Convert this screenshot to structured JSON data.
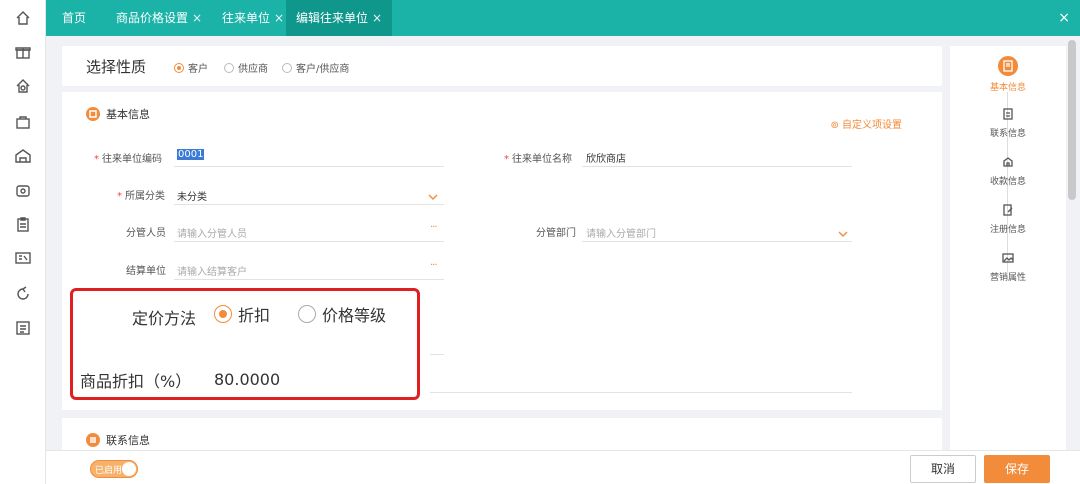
{
  "tabs": [
    {
      "label": "首页",
      "closable": false
    },
    {
      "label": "商品价格设置",
      "closable": true
    },
    {
      "label": "往来单位",
      "closable": true
    },
    {
      "label": "编辑往来单位",
      "closable": true
    }
  ],
  "tab_close_glyph": "×",
  "header": {
    "title": "选择性质",
    "options": [
      "客户",
      "供应商",
      "客户/供应商"
    ],
    "selected": "客户"
  },
  "basic": {
    "title": "基本信息",
    "custom_link": "⊚ 自定义项设置",
    "fields": {
      "code_label": "往来单位编码",
      "code_value": "0001",
      "name_label": "往来单位名称",
      "name_value": "欣欣商店",
      "category_label": "所属分类",
      "category_value": "未分类",
      "manager_label": "分管人员",
      "manager_placeholder": "请输入分管人员",
      "dept_label": "分管部门",
      "dept_placeholder": "请输入分管部门",
      "settle_label": "结算单位",
      "settle_placeholder": "请输入结算客户"
    },
    "required_mark": "*",
    "more_glyph": "···"
  },
  "pricing": {
    "method_label": "定价方法",
    "options": [
      "折扣",
      "价格等级"
    ],
    "selected": "折扣",
    "discount_label": "商品折扣（%）",
    "discount_value": "80.0000"
  },
  "contact": {
    "title": "联系信息"
  },
  "right_nav": [
    {
      "label": "基本信息",
      "icon": "document-icon",
      "active": true
    },
    {
      "label": "联系信息",
      "icon": "contact-card-icon",
      "active": false
    },
    {
      "label": "收款信息",
      "icon": "payment-icon",
      "active": false
    },
    {
      "label": "注册信息",
      "icon": "edit-document-icon",
      "active": false
    },
    {
      "label": "营销属性",
      "icon": "image-icon",
      "active": false
    }
  ],
  "footer": {
    "toggle_label": "已启用",
    "cancel_label": "取消",
    "save_label": "保存"
  },
  "colors": {
    "teal": "#1bb3a7",
    "accent": "#f28b3a",
    "highlight": "#e02020"
  }
}
